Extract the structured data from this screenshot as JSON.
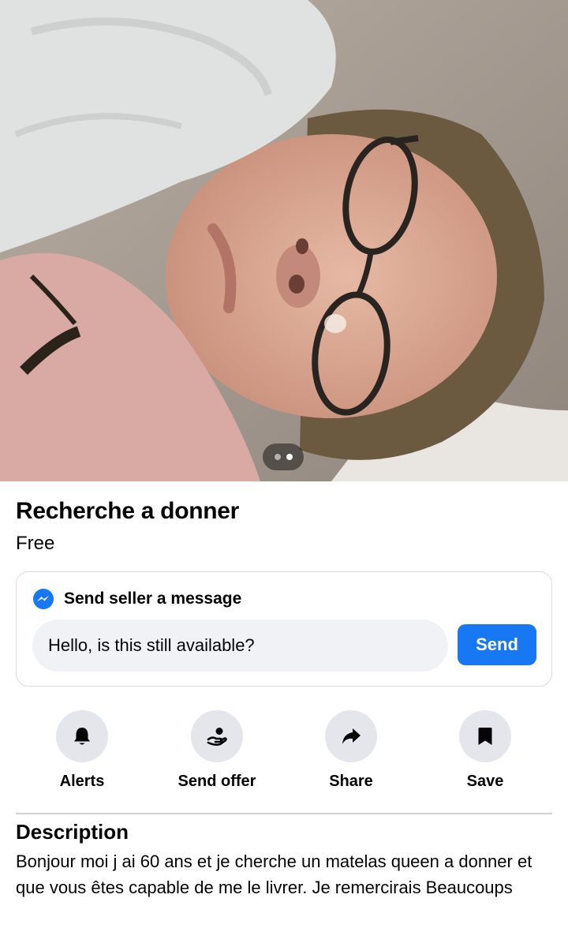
{
  "photo": {
    "alt": "listing photo",
    "pager_count": 2,
    "pager_active": 1
  },
  "listing": {
    "title": "Recherche a donner",
    "price": "Free"
  },
  "message": {
    "header": "Send seller a message",
    "input_value": "Hello, is this still available?",
    "send_label": "Send"
  },
  "actions": [
    {
      "label": "Alerts",
      "icon": "bell-icon"
    },
    {
      "label": "Send offer",
      "icon": "offer-icon"
    },
    {
      "label": "Share",
      "icon": "share-icon"
    },
    {
      "label": "Save",
      "icon": "bookmark-icon"
    }
  ],
  "description": {
    "title": "Description",
    "text": "Bonjour moi j ai 60 ans et je cherche un matelas queen a donner et que vous êtes capable de me le livrer. Je remercirais Beaucoups"
  },
  "colors": {
    "accent": "#1877f2",
    "icon_bg": "#e4e6eb",
    "input_bg": "#f0f2f5"
  }
}
